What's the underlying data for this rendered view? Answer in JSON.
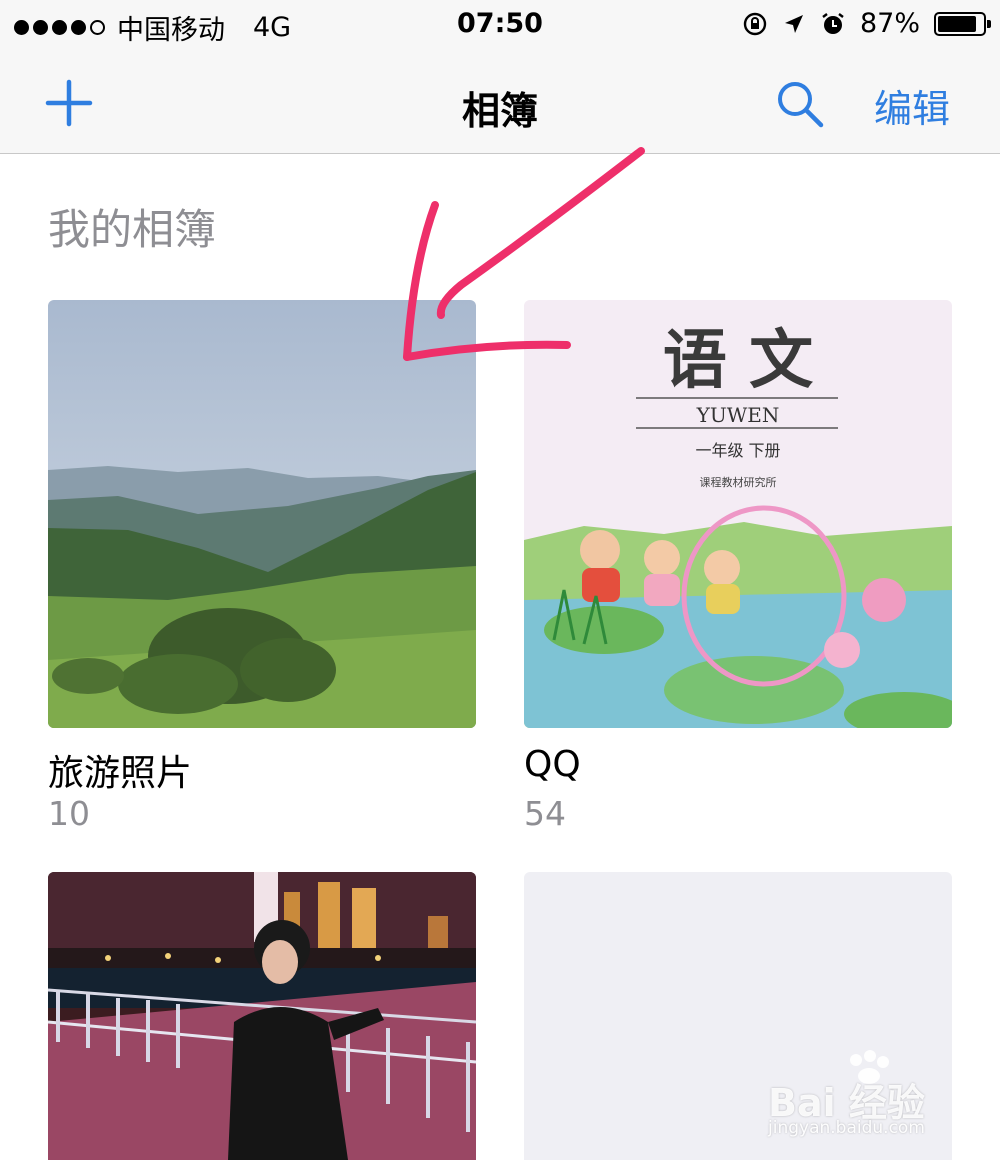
{
  "status_bar": {
    "carrier": "中国移动",
    "network": "4G",
    "time": "07:50",
    "battery_percent": 87,
    "battery_label": "87%",
    "icons": [
      "rotation-lock-icon",
      "location-arrow-icon",
      "alarm-icon",
      "battery-icon"
    ]
  },
  "nav": {
    "add_icon": "plus-icon",
    "title": "相簿",
    "search_icon": "search-icon",
    "edit_label": "编辑",
    "accent_color": "#2f7ee0"
  },
  "section": {
    "title": "我的相簿"
  },
  "albums": [
    {
      "name": "旅游照片",
      "count": "10"
    },
    {
      "name": "QQ",
      "count": "54",
      "cover_title": "语 文",
      "cover_subtitle": "YUWEN",
      "cover_grade": "一年级   下册",
      "cover_publisher": "课程教材研究所"
    },
    {
      "name": "",
      "count": ""
    },
    {
      "name": "",
      "count": ""
    }
  ],
  "watermark": {
    "main": "Bai 经验",
    "sub": "jingyan.baidu.com"
  },
  "annotation": {
    "arrow_color": "#ee2f6a"
  }
}
